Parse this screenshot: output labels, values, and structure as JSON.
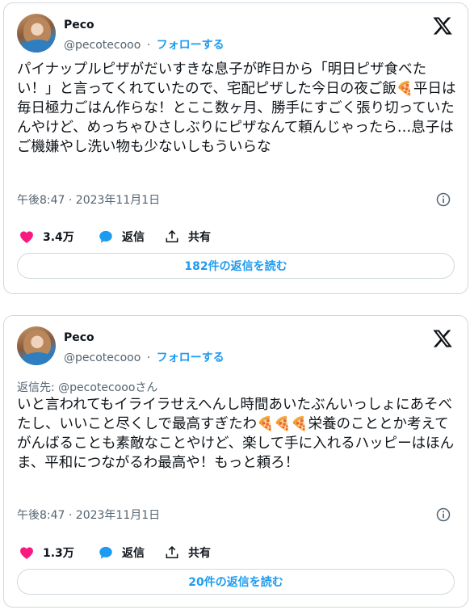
{
  "tweets": [
    {
      "author_name": "Peco",
      "handle": "@pecotecooo",
      "separator": "·",
      "follow_label": "フォローする",
      "reply_to": "",
      "text_parts": [
        "パイナップルピザがだいすきな息子が昨日から「明日ピザ食べたい！」と言ってくれていたので、宅配ピザした今日の夜ご飯",
        "🍕",
        "平日は毎日極力ごはん作らな！とここ数ヶ月、勝手にすごく張り切っていたんやけど、めっちゃひさしぶりにピザなんて頼んじゃったら…息子はご機嫌やし洗い物も少ないしもういらな"
      ],
      "timestamp": "午後8:47 · 2023年11月1日",
      "like_count": "3.4万",
      "reply_label": "返信",
      "share_label": "共有",
      "read_replies_label": "182件の返信を読む"
    },
    {
      "author_name": "Peco",
      "handle": "@pecotecooo",
      "separator": "·",
      "follow_label": "フォローする",
      "reply_to": "返信先: @pecotecoooさん",
      "text_parts": [
        "いと言われてもイライラせえへんし時間あいたぶんいっしょにあそべたし、いいこと尽くしで最高すぎたわ",
        "🍕🍕🍕",
        "栄養のこととか考えてがんばることも素敵なことやけど、楽して手に入れるハッピーはほんま、平和につながるわ最高や！もっと頼ろ！"
      ],
      "timestamp": "午後8:47 · 2023年11月1日",
      "like_count": "1.3万",
      "reply_label": "返信",
      "share_label": "共有",
      "read_replies_label": "20件の返信を読む"
    }
  ],
  "icons": {
    "brand": "x-logo-icon",
    "info": "info-icon",
    "like": "heart-icon",
    "reply": "speech-bubble-icon",
    "share": "share-icon"
  },
  "colors": {
    "accent": "#1d9bf0",
    "like": "#f91880",
    "text": "#0f1419",
    "muted": "#536471",
    "border": "#cfd9de"
  }
}
